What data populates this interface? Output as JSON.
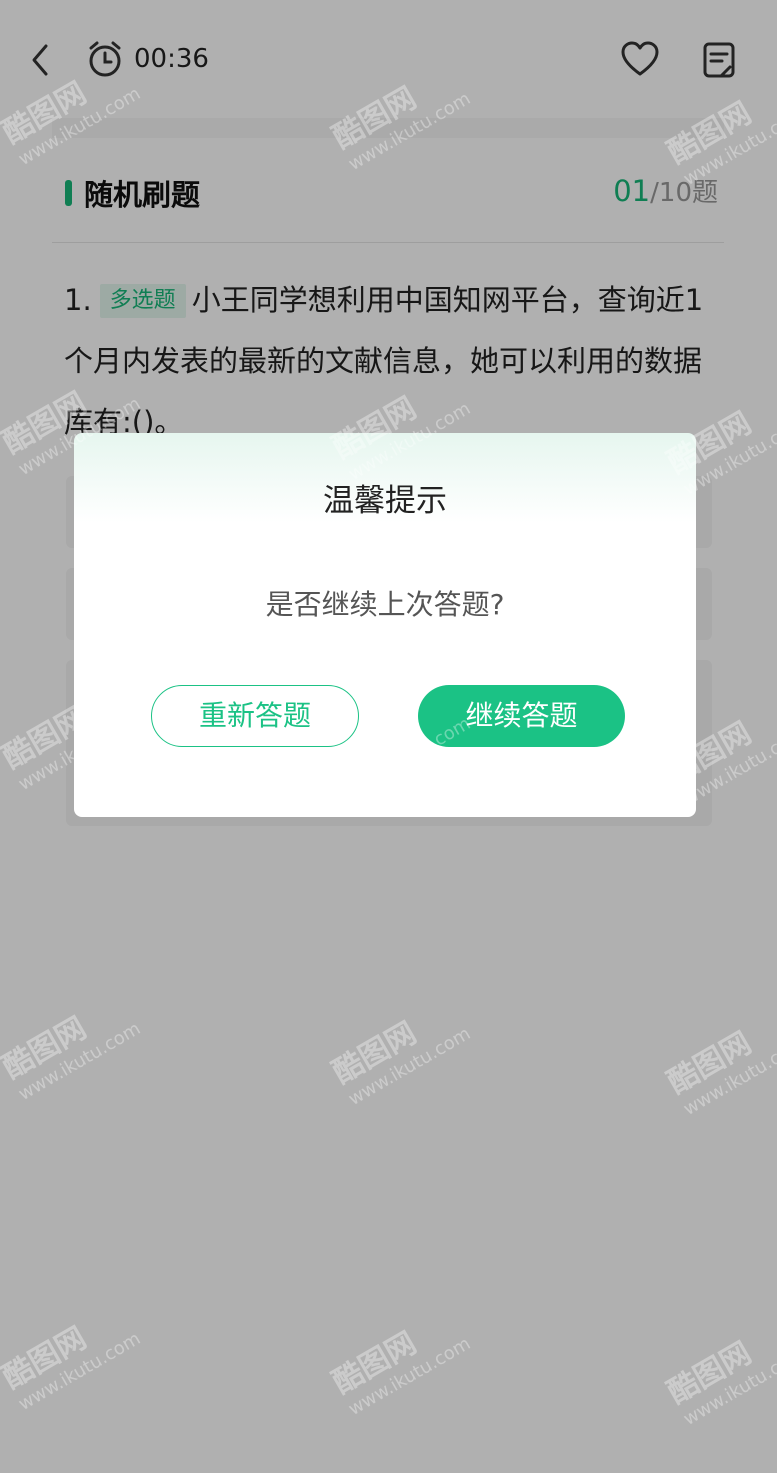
{
  "topbar": {
    "timer": "00:36"
  },
  "section": {
    "title": "随机刷题",
    "progress_current": "01",
    "progress_total": "/10题"
  },
  "question": {
    "number": "1.",
    "type": "多选题",
    "text": "小王同学想利用中国知网平台，查询近1个月内发表的最新的文献信息，她可以利用的数据库有:()。"
  },
  "dialog": {
    "title": "温馨提示",
    "message": "是否继续上次答题?",
    "restart_label": "重新答题",
    "continue_label": "继续答题"
  },
  "watermark": {
    "logo_text": "酷图网",
    "url": "www.ikutu.com"
  },
  "colors": {
    "accent": "#1bc285",
    "overlay": "rgba(0,0,0,0.31)"
  }
}
